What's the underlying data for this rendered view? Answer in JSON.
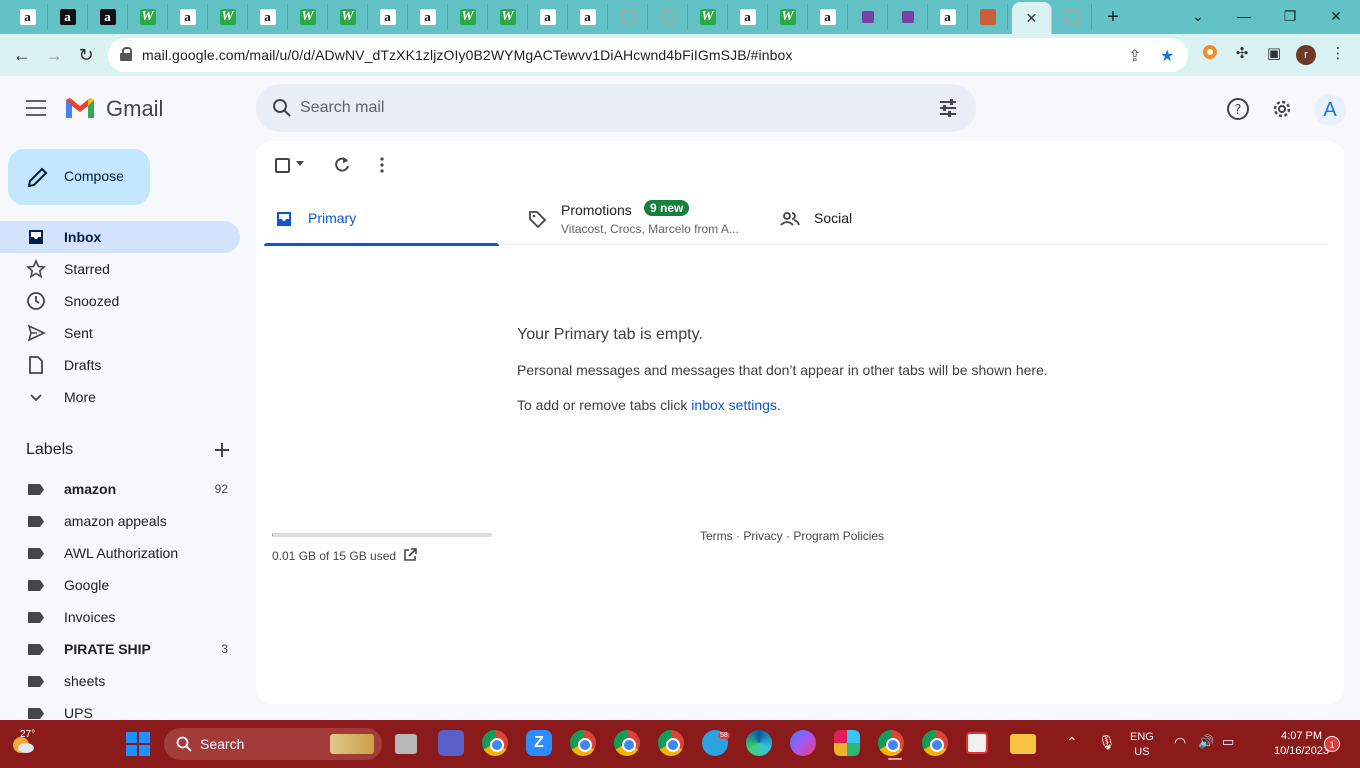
{
  "browser": {
    "url": "mail.google.com/mail/u/0/d/ADwNV_dTzXK1zljzOIy0B2WYMgACTewvv1DiAHcwnd4bFiIGmSJB/#inbox",
    "tabs": [
      {
        "icon": "amazon-icon",
        "glyph": "a"
      },
      {
        "icon": "amazon-icon",
        "glyph": "a",
        "dark": true
      },
      {
        "icon": "amazon-icon",
        "glyph": "a",
        "dark": true
      },
      {
        "icon": "w-icon",
        "glyph": "W"
      },
      {
        "icon": "amazon-icon",
        "glyph": "a"
      },
      {
        "icon": "w-icon",
        "glyph": "W"
      },
      {
        "icon": "amazon-icon",
        "glyph": "a"
      },
      {
        "icon": "w-icon",
        "glyph": "W"
      },
      {
        "icon": "w-icon",
        "glyph": "W"
      },
      {
        "icon": "amazon-icon",
        "glyph": "a"
      },
      {
        "icon": "amazon-icon",
        "glyph": "a"
      },
      {
        "icon": "w-icon",
        "glyph": "W"
      },
      {
        "icon": "w-icon",
        "glyph": "W"
      },
      {
        "icon": "amazon-icon",
        "glyph": "a"
      },
      {
        "icon": "amazon-icon",
        "glyph": "a"
      },
      {
        "icon": "gray-icon",
        "glyph": ""
      },
      {
        "icon": "gray-icon",
        "glyph": ""
      },
      {
        "icon": "w-icon",
        "glyph": "W"
      },
      {
        "icon": "amazon-icon",
        "glyph": "a"
      },
      {
        "icon": "w-icon",
        "glyph": "W"
      },
      {
        "icon": "amazon-icon",
        "glyph": "a"
      },
      {
        "icon": "purple-icon",
        "glyph": ""
      },
      {
        "icon": "purple-icon",
        "glyph": ""
      },
      {
        "icon": "amazon-icon",
        "glyph": "a"
      },
      {
        "icon": "boat-icon",
        "glyph": ""
      }
    ],
    "active_tab_close": "✕",
    "new_tab": "+",
    "profile_initial": "r"
  },
  "gmail": {
    "brand": "Gmail",
    "search_placeholder": "Search mail",
    "avatar_initial": "A",
    "compose": "Compose",
    "nav": [
      {
        "label": "Inbox",
        "icon": "inbox-icon",
        "active": true
      },
      {
        "label": "Starred",
        "icon": "star-icon"
      },
      {
        "label": "Snoozed",
        "icon": "clock-icon"
      },
      {
        "label": "Sent",
        "icon": "send-icon"
      },
      {
        "label": "Drafts",
        "icon": "draft-icon"
      },
      {
        "label": "More",
        "icon": "chevron-down-icon"
      }
    ],
    "labels_title": "Labels",
    "labels": [
      {
        "name": "amazon",
        "count": "92",
        "bold": true
      },
      {
        "name": "amazon appeals",
        "count": ""
      },
      {
        "name": "AWL Authorization",
        "count": ""
      },
      {
        "name": "Google",
        "count": ""
      },
      {
        "name": "Invoices",
        "count": ""
      },
      {
        "name": "PIRATE SHIP",
        "count": "3",
        "bold": true
      },
      {
        "name": "sheets",
        "count": ""
      },
      {
        "name": "UPS",
        "count": ""
      }
    ],
    "tabs": {
      "primary": "Primary",
      "promotions": "Promotions",
      "promotions_badge": "9 new",
      "promotions_senders": "Vitacost, Crocs, Marcelo from A...",
      "social": "Social"
    },
    "empty": {
      "title": "Your Primary tab is empty.",
      "message": "Personal messages and messages that don’t appear in other tabs will be shown here.",
      "hint_prefix": "To add or remove tabs click ",
      "hint_link": "inbox settings",
      "hint_suffix": "."
    },
    "storage": {
      "text": "0.01 GB of 15 GB used",
      "fraction": 0.001
    },
    "footer": {
      "terms": "Terms",
      "privacy": "Privacy",
      "policies": "Program Policies",
      "sep": " · "
    }
  },
  "taskbar": {
    "weather_temp": "27°",
    "search_label": "Search",
    "lang_1": "ENG",
    "lang_2": "US",
    "time": "4:07 PM",
    "date": "10/16/2023",
    "notification_count": "1",
    "telegram_badge": "58"
  }
}
